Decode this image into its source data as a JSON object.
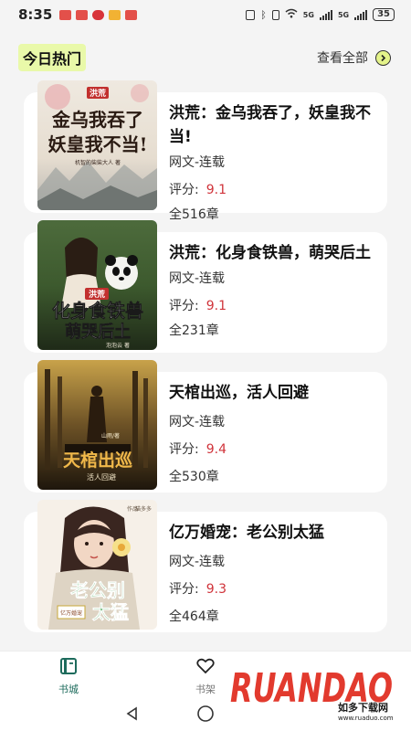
{
  "status_bar": {
    "time": "8:35",
    "network_1": "5G",
    "network_2": "5G",
    "battery": "35"
  },
  "section": {
    "title": "今日热门",
    "view_all": "查看全部"
  },
  "books": [
    {
      "title": "洪荒：金乌我吞了，妖皇我不当!",
      "category": "网文-连载",
      "score_label": "评分:",
      "score": "9.1",
      "chapters": "全516章",
      "cover": {
        "tag": "洪荒",
        "line1": "金乌我吞了",
        "line2": "妖皇我不当!",
        "author": "机智的柴柴大人 著"
      }
    },
    {
      "title": "洪荒：化身食铁兽，萌哭后土",
      "category": "网文-连载",
      "score_label": "评分:",
      "score": "9.1",
      "chapters": "全231章",
      "cover": {
        "tag": "洪荒",
        "line1": "化身食铁兽",
        "line2": "萌哭后土",
        "author": "泡泡云 著"
      }
    },
    {
      "title": "天棺出巡，活人回避",
      "category": "网文-连载",
      "score_label": "评分:",
      "score": "9.4",
      "chapters": "全530章",
      "cover": {
        "author": "山雨/著",
        "line1": "天棺出巡",
        "line2": "活人回避"
      }
    },
    {
      "title": "亿万婚宠：老公别太猛",
      "category": "网文-连载",
      "score_label": "评分:",
      "score": "9.3",
      "chapters": "全464章",
      "cover": {
        "author": "猫多多",
        "author_prefix": "作品",
        "line1": "老公别",
        "line2": "太猛",
        "tag": "亿万婚宠"
      }
    }
  ],
  "tabs": [
    {
      "label": "书城",
      "icon": "book-icon",
      "active": true
    },
    {
      "label": "书架",
      "icon": "heart-icon",
      "active": false
    }
  ],
  "watermark": {
    "brand": "RUANDAO",
    "cn": "如多下载网",
    "url": "www.ruaduo.com"
  },
  "colors": {
    "accent": "#1d6b5c",
    "score": "#d0333a",
    "highlight": "#e9f9a9"
  }
}
